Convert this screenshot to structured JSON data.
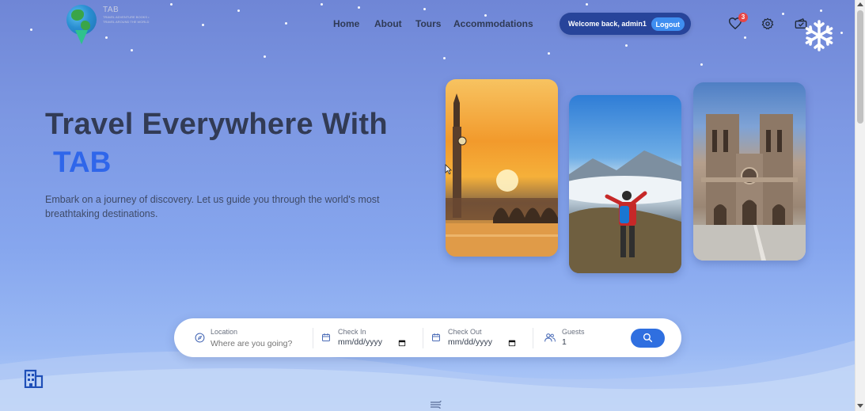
{
  "header": {
    "logo": {
      "brand": "TAB",
      "tagline": "TRAVEL ADVENTURE BOOKS • TRAVEL AROUND THE WORLD"
    },
    "nav": [
      {
        "label": "Home"
      },
      {
        "label": "About"
      },
      {
        "label": "Tours"
      },
      {
        "label": "Accommodations"
      }
    ],
    "welcome_text": "Welcome back, admin1",
    "logout_label": "Logout",
    "favorites_count": "3",
    "icons": [
      "heart-icon",
      "gear-icon",
      "ticket-icon",
      "snowflake-icon"
    ]
  },
  "hero": {
    "title": "Travel Everywhere With",
    "accent": "TAB",
    "description": "Embark on a journey of discovery. Let us guide you through the world's most breathtaking destinations."
  },
  "search": {
    "location": {
      "label": "Location",
      "placeholder": "Where are you going?"
    },
    "check_in": {
      "label": "Check In",
      "value": "mm/dd/yyyy"
    },
    "check_out": {
      "label": "Check Out",
      "value": "mm/dd/yyyy"
    },
    "guests": {
      "label": "Guests",
      "value": "1"
    }
  },
  "colors": {
    "accent": "#2f66ea",
    "nav_dark": "#27449a",
    "badge": "#e84646"
  }
}
